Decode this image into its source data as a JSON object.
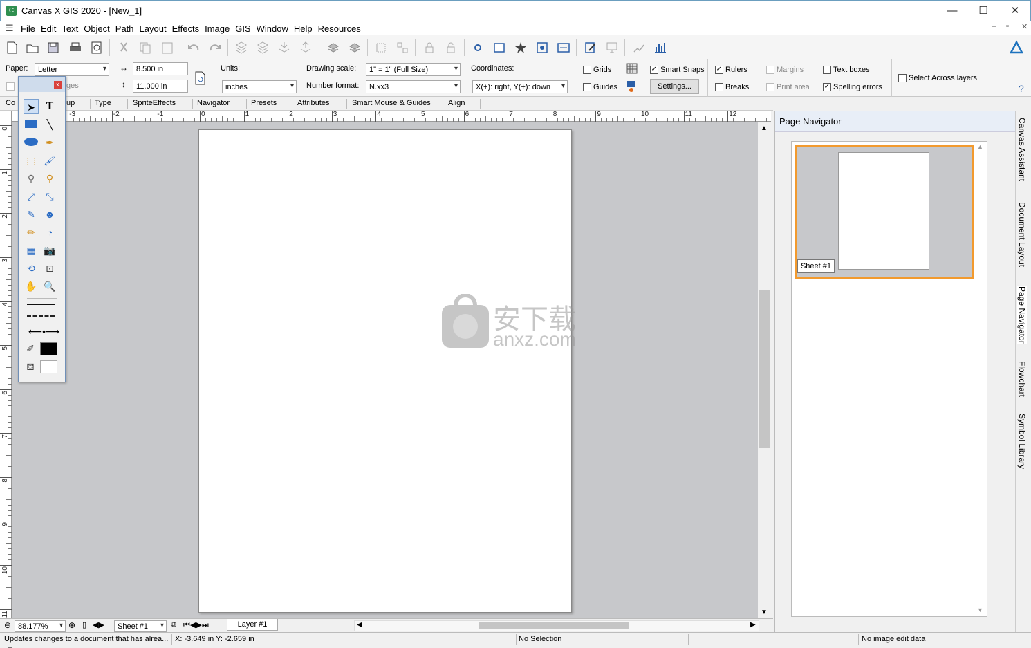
{
  "window": {
    "title": "Canvas X GIS 2020 - [New_1]",
    "min": "—",
    "max": "☐",
    "close": "✕"
  },
  "menu": [
    "File",
    "Edit",
    "Text",
    "Object",
    "Path",
    "Layout",
    "Effects",
    "Image",
    "GIS",
    "Window",
    "Help",
    "Resources"
  ],
  "mdi": {
    "min": "–",
    "restore": "▫",
    "close": "✕"
  },
  "props": {
    "paper_label": "Paper:",
    "paper_value": "Letter",
    "width_value": "8.500 in",
    "height_value": "11.000 in",
    "pages_label": "ges",
    "units_label": "Units:",
    "units_value": "inches",
    "scale_label": "Drawing scale:",
    "scale_value": "1\" = 1\"  (Full Size)",
    "numfmt_label": "Number format:",
    "numfmt_value": "N.xx3",
    "coords_label": "Coordinates:",
    "coords_value": "X(+): right, Y(+): down",
    "settings_button": "Settings...",
    "grids": "Grids",
    "guides": "Guides",
    "smart_snaps": "Smart Snaps",
    "rulers": "Rulers",
    "breaks": "Breaks",
    "margins": "Margins",
    "print_area": "Print area",
    "text_boxes": "Text boxes",
    "spelling_errors": "Spelling errors",
    "select_across": "Select Across layers",
    "help": "?"
  },
  "tabs": [
    "Co",
    "up",
    "Type",
    "SpriteEffects",
    "Navigator",
    "Presets",
    "Attributes",
    "Smart Mouse & Guides",
    "Align"
  ],
  "ruler_h": [
    "-3",
    "-2",
    "-1",
    "0",
    "1",
    "2",
    "3",
    "4",
    "5",
    "6",
    "7",
    "8",
    "9",
    "10",
    "11",
    "12"
  ],
  "ruler_v": [
    "0",
    "1",
    "2",
    "3",
    "4",
    "5",
    "6",
    "7",
    "8",
    "9",
    "10",
    "11"
  ],
  "navigator": {
    "title": "Page Navigator",
    "sheet_label": "Sheet #1"
  },
  "side_tabs": [
    "Canvas Assistant",
    "Document Layout",
    "Page Navigator",
    "Flowchart",
    "Symbol Library"
  ],
  "bottom": {
    "zoom": "88.177%",
    "sheet": "Sheet #1",
    "layer": "Layer #1"
  },
  "status": {
    "hint": "Updates changes to a document that has alrea...",
    "coords": "X: -3.649 in Y: -2.659 in",
    "selection": "No Selection",
    "image": "No image edit data"
  },
  "watermark": {
    "cn": "安下载",
    "latin": "anxz.com"
  }
}
